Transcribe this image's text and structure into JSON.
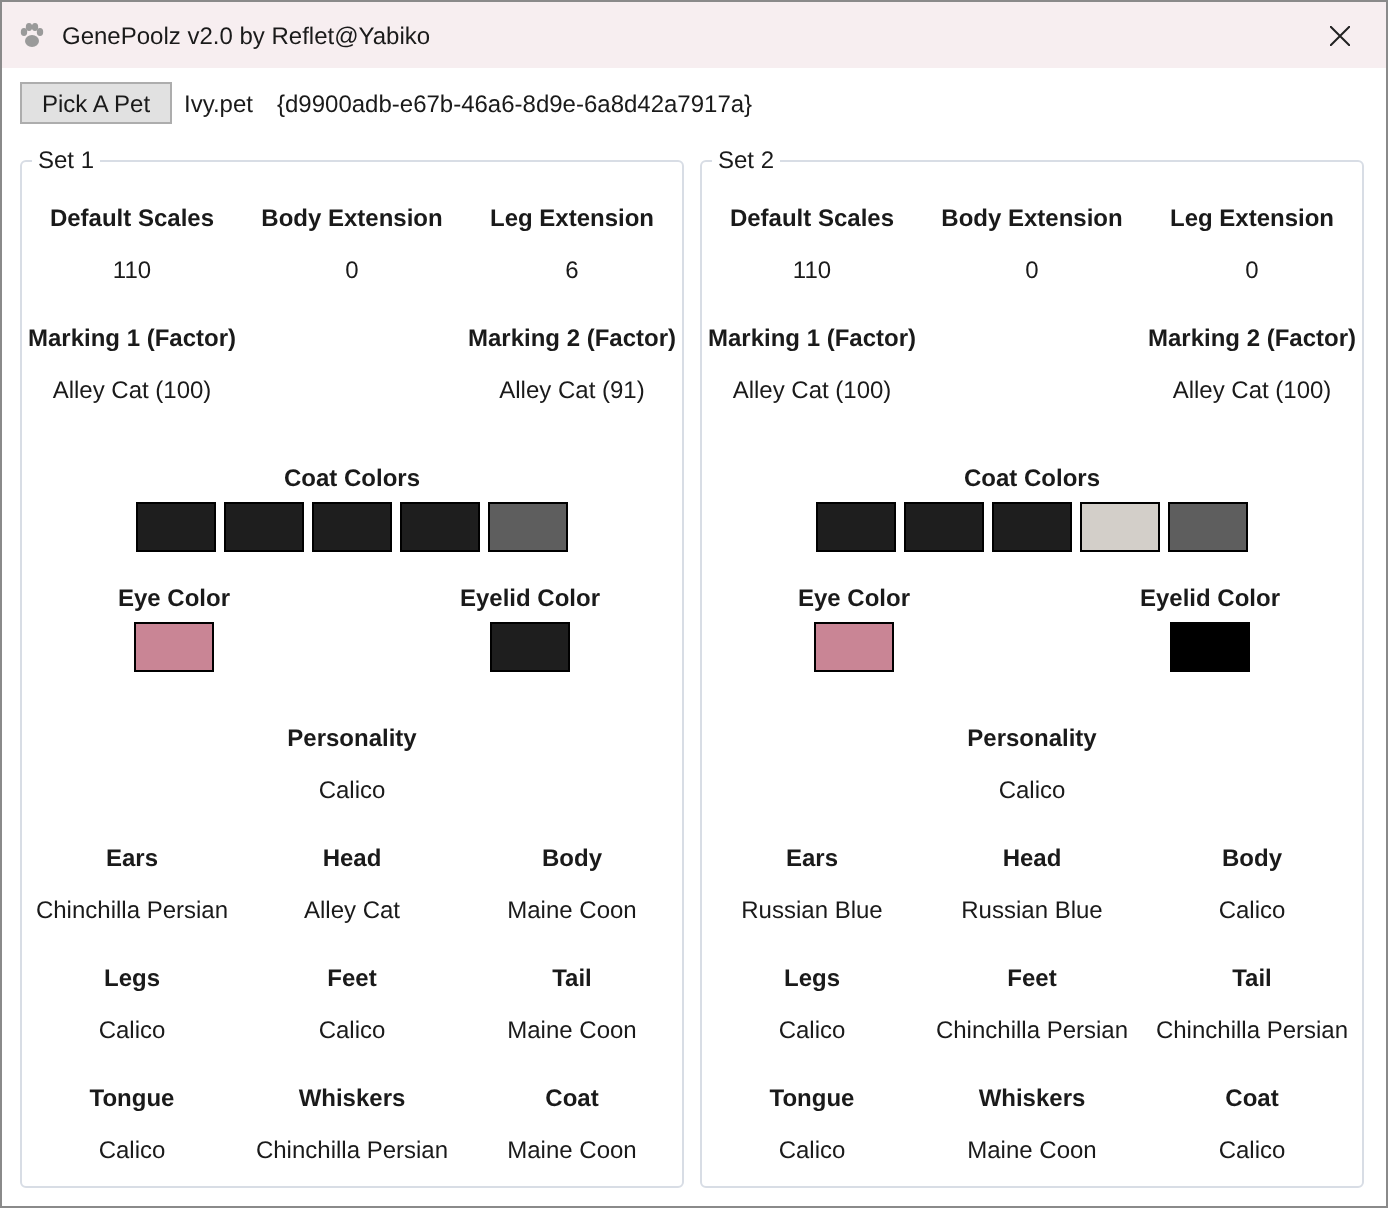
{
  "window": {
    "title": "GenePoolz v2.0 by Reflet@Yabiko"
  },
  "toolbar": {
    "button": "Pick A Pet",
    "file": "Ivy.pet",
    "guid": "{d9900adb-e67b-46a6-8d9e-6a8d42a7917a}"
  },
  "sets": [
    {
      "title": "Set 1",
      "scales": [
        {
          "label": "Default Scales",
          "value": "110"
        },
        {
          "label": "Body Extension",
          "value": "0"
        },
        {
          "label": "Leg Extension",
          "value": "6"
        }
      ],
      "markings": [
        {
          "label": "Marking 1 (Factor)",
          "value": "Alley Cat (100)"
        },
        {
          "label": "Marking 2 (Factor)",
          "value": "Alley Cat (91)"
        }
      ],
      "coat_colors": {
        "label": "Coat Colors",
        "swatches": [
          {
            "color": "#1e1e1e"
          },
          {
            "color": "#1e1e1e"
          },
          {
            "color": "#1e1e1e"
          },
          {
            "color": "#1e1e1e"
          },
          {
            "color": "#5e5e5e"
          }
        ]
      },
      "eye_color": {
        "label": "Eye Color",
        "color": "#c98595"
      },
      "eyelid_color": {
        "label": "Eyelid Color",
        "color": "#1e1e1e"
      },
      "personality": {
        "label": "Personality",
        "value": "Calico"
      },
      "traits": [
        {
          "label": "Ears",
          "value": "Chinchilla Persian"
        },
        {
          "label": "Head",
          "value": "Alley Cat"
        },
        {
          "label": "Body",
          "value": "Maine Coon"
        },
        {
          "label": "Legs",
          "value": "Calico"
        },
        {
          "label": "Feet",
          "value": "Calico"
        },
        {
          "label": "Tail",
          "value": "Maine Coon"
        },
        {
          "label": "Tongue",
          "value": "Calico"
        },
        {
          "label": "Whiskers",
          "value": "Chinchilla Persian"
        },
        {
          "label": "Coat",
          "value": "Maine Coon"
        }
      ]
    },
    {
      "title": "Set 2",
      "scales": [
        {
          "label": "Default Scales",
          "value": "110"
        },
        {
          "label": "Body Extension",
          "value": "0"
        },
        {
          "label": "Leg Extension",
          "value": "0"
        }
      ],
      "markings": [
        {
          "label": "Marking 1 (Factor)",
          "value": "Alley Cat (100)"
        },
        {
          "label": "Marking 2 (Factor)",
          "value": "Alley Cat (100)"
        }
      ],
      "coat_colors": {
        "label": "Coat Colors",
        "swatches": [
          {
            "color": "#1e1e1e"
          },
          {
            "color": "#1e1e1e"
          },
          {
            "color": "#1e1e1e"
          },
          {
            "color": "#d3cfc9"
          },
          {
            "color": "#5e5e5e"
          }
        ]
      },
      "eye_color": {
        "label": "Eye Color",
        "color": "#c98595"
      },
      "eyelid_color": {
        "label": "Eyelid Color",
        "color": "#000000"
      },
      "personality": {
        "label": "Personality",
        "value": "Calico"
      },
      "traits": [
        {
          "label": "Ears",
          "value": "Russian Blue"
        },
        {
          "label": "Head",
          "value": "Russian Blue"
        },
        {
          "label": "Body",
          "value": "Calico"
        },
        {
          "label": "Legs",
          "value": "Calico"
        },
        {
          "label": "Feet",
          "value": "Chinchilla Persian"
        },
        {
          "label": "Tail",
          "value": "Chinchilla Persian"
        },
        {
          "label": "Tongue",
          "value": "Calico"
        },
        {
          "label": "Whiskers",
          "value": "Maine Coon"
        },
        {
          "label": "Coat",
          "value": "Calico"
        }
      ]
    }
  ]
}
